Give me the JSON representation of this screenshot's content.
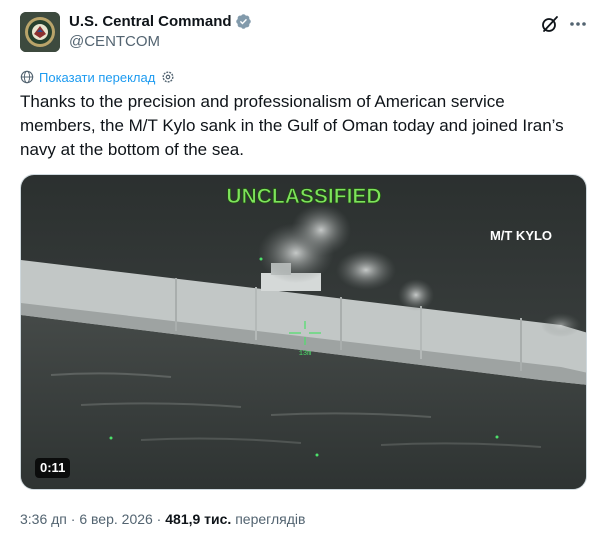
{
  "author": {
    "name": "U.S. Central Command",
    "handle": "@CENTCOM",
    "verified": true,
    "avatar_icon": "centcom-seal-icon"
  },
  "actions": {
    "grok_icon": "grok-icon",
    "more_icon": "more-icon"
  },
  "translate": {
    "label": "Показати переклад"
  },
  "tweet": {
    "text": "Thanks to the precision and professionalism of American service members, the M/T Kylo sank in the Gulf of Oman today and joined Iran’s navy at the bottom of the sea."
  },
  "video": {
    "overlay_title": "UNCLASSIFIED",
    "overlay_label": "M/T KYLO",
    "overlay_tag": "13m",
    "duration": "0:11",
    "colors": {
      "title": "#7ee35c",
      "sea": "#3a3f3e",
      "hull": "#c8cccb"
    }
  },
  "meta": {
    "time": "3:36 дп",
    "separator": " · ",
    "date": "6 вер. 2026",
    "views_count": "481,9 тис.",
    "views_label": "переглядів"
  }
}
